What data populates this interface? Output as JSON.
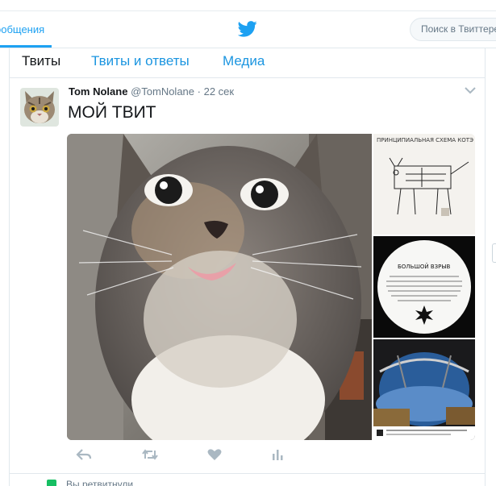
{
  "nav": {
    "messages_label": "ообщения",
    "search_placeholder": "Поиск в Твиттере"
  },
  "tabs": [
    {
      "label": "Твиты"
    },
    {
      "label": "Твиты и ответы"
    },
    {
      "label": "Медиа"
    }
  ],
  "tweet": {
    "fullname": "Tom Nolane",
    "username": "@TomNolane",
    "separator": "·",
    "time": "22 сек",
    "text": "МОЙ ТВИТ",
    "media": [
      {
        "icon": "cat-photo"
      },
      {
        "icon": "cat-schematic-image",
        "caption": "ПРИНЦИПИАЛЬНАЯ СХЕМА КОТЭ"
      },
      {
        "icon": "big-bang-image",
        "caption": "БОЛЬШОЙ ВЗРЫВ"
      },
      {
        "icon": "space-window-image"
      }
    ],
    "actions": [
      "reply-icon",
      "retweet-icon",
      "like-icon",
      "analytics-icon"
    ]
  },
  "footer": {
    "retweeted_label": "Вы ретвитнули"
  },
  "colors": {
    "accent": "#1da1f2",
    "link": "#1b95e0",
    "muted": "#657786",
    "border": "#e1e8ed"
  }
}
